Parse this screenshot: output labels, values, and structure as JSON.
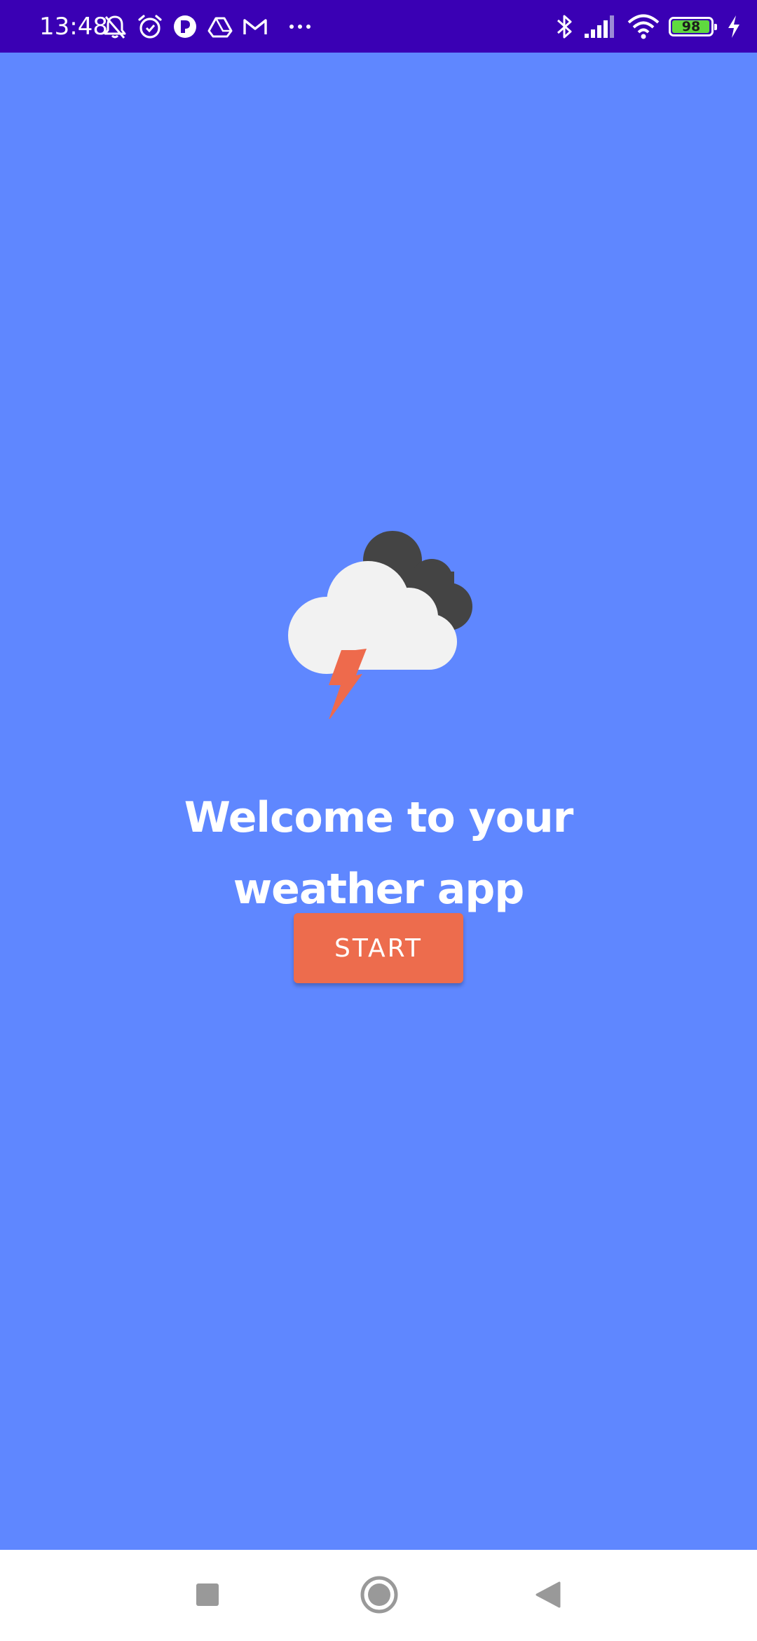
{
  "status_bar": {
    "time": "13:48",
    "battery_level": "98",
    "battery_fraction": 0.98,
    "notification_icons": [
      "bell-muted-icon",
      "alarm-icon",
      "app-p-icon",
      "drive-icon",
      "gmail-icon",
      "more-dots-icon"
    ],
    "system_icons": [
      "bluetooth-icon",
      "signal-icon",
      "wifi-icon",
      "battery-icon",
      "charging-icon"
    ],
    "background_color": "#3a00b4"
  },
  "main": {
    "background_color": "#5f87ff",
    "illustration": "thunderstorm-cloud-icon",
    "welcome_text": "Welcome to your weather app",
    "start_button_label": "START",
    "start_button_color": "#ed6c4d"
  },
  "nav_bar": {
    "items": [
      "recents-square-icon",
      "home-circle-icon",
      "back-triangle-icon"
    ]
  }
}
